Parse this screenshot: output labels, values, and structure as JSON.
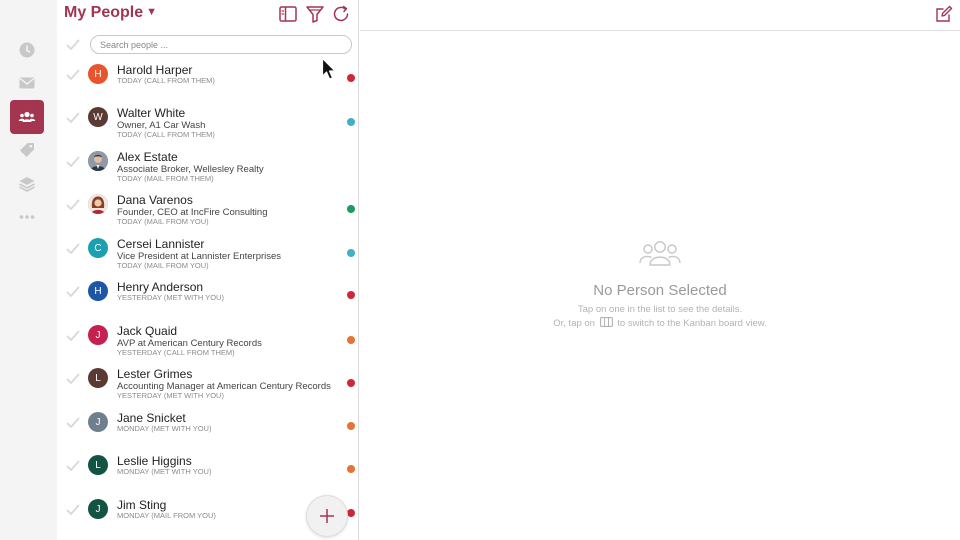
{
  "header": {
    "title": "My People",
    "caret": "▼",
    "icons": [
      "columns-icon",
      "filter-icon",
      "refresh-icon"
    ]
  },
  "search": {
    "placeholder": "Search people ...",
    "value": ""
  },
  "rail": {
    "items": [
      {
        "name": "recent-icon",
        "active": false
      },
      {
        "name": "mail-icon",
        "active": false
      },
      {
        "name": "people-icon",
        "active": true
      },
      {
        "name": "tag-icon",
        "active": false
      },
      {
        "name": "layers-icon",
        "active": false
      },
      {
        "name": "more-icon",
        "active": false
      }
    ]
  },
  "people": [
    {
      "name": "Harold Harper",
      "subtitle": "",
      "meta": "TODAY (CALL FROM THEM)",
      "initial": "H",
      "avatar_color": "#e8542b",
      "avatar_type": "initial",
      "dot_color": "#d0263a"
    },
    {
      "name": "Walter White",
      "subtitle": "Owner, A1 Car Wash",
      "meta": "TODAY (CALL FROM THEM)",
      "initial": "W",
      "avatar_color": "#5a3a32",
      "avatar_type": "initial",
      "dot_color": "#3eb0c7"
    },
    {
      "name": "Alex Estate",
      "subtitle": "Associate Broker, Wellesley Realty",
      "meta": "TODAY (MAIL FROM THEM)",
      "initial": "A",
      "avatar_color": "#7f8c99",
      "avatar_type": "photo-man",
      "dot_color": ""
    },
    {
      "name": "Dana Varenos",
      "subtitle": "Founder, CEO at IncFire Consulting",
      "meta": "TODAY (MAIL FROM YOU)",
      "initial": "D",
      "avatar_color": "#b9785c",
      "avatar_type": "photo-woman",
      "dot_color": "#1e9a63"
    },
    {
      "name": "Cersei Lannister",
      "subtitle": "Vice President at Lannister Enterprises",
      "meta": "TODAY (MAIL FROM YOU)",
      "initial": "C",
      "avatar_color": "#1b9fb1",
      "avatar_type": "initial",
      "dot_color": "#3eb0c7"
    },
    {
      "name": "Henry Anderson",
      "subtitle": "",
      "meta": "YESTERDAY (MET WITH YOU)",
      "initial": "H",
      "avatar_color": "#1d56a6",
      "avatar_type": "initial",
      "dot_color": "#d0263a"
    },
    {
      "name": "Jack Quaid",
      "subtitle": "AVP at American Century Records",
      "meta": "YESTERDAY (CALL FROM THEM)",
      "initial": "J",
      "avatar_color": "#c5204f",
      "avatar_type": "initial",
      "dot_color": "#ea7132"
    },
    {
      "name": "Lester Grimes",
      "subtitle": "Accounting Manager at American Century Records",
      "meta": "YESTERDAY (MET WITH YOU)",
      "initial": "L",
      "avatar_color": "#5a3a32",
      "avatar_type": "initial",
      "dot_color": "#d0263a"
    },
    {
      "name": "Jane Snicket",
      "subtitle": "",
      "meta": "MONDAY (MET WITH YOU)",
      "initial": "J",
      "avatar_color": "#6e7f8e",
      "avatar_type": "initial",
      "dot_color": "#ea7132"
    },
    {
      "name": "Leslie Higgins",
      "subtitle": "",
      "meta": "MONDAY (MET WITH YOU)",
      "initial": "L",
      "avatar_color": "#135343",
      "avatar_type": "initial",
      "dot_color": "#ea7132"
    },
    {
      "name": "Jim Sting",
      "subtitle": "",
      "meta": "MONDAY (MAIL FROM YOU)",
      "initial": "J",
      "avatar_color": "#135343",
      "avatar_type": "initial",
      "dot_color": "#d0263a"
    }
  ],
  "detail": {
    "empty_title": "No Person Selected",
    "empty_line1": "Tap on one in the list to see the details.",
    "empty_line2_before": "Or, tap on",
    "empty_line2_after": "to switch to the Kanban board view."
  },
  "colors": {
    "accent": "#a33551",
    "rail_bg": "#f4f4f4"
  }
}
